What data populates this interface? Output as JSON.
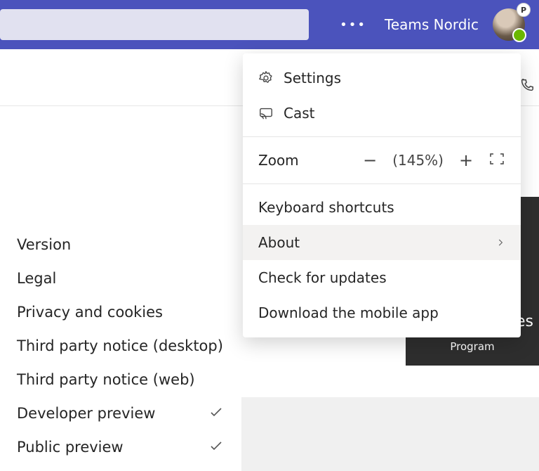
{
  "header": {
    "tenant_name": "Teams Nordic",
    "avatar_badge": "P"
  },
  "menu": {
    "settings": "Settings",
    "cast": "Cast",
    "zoom_label": "Zoom",
    "zoom_value": "(145%)",
    "keyboard_shortcuts": "Keyboard shortcuts",
    "about": "About",
    "check_updates": "Check for updates",
    "download_mobile": "Download the mobile app"
  },
  "about_submenu": {
    "items": [
      "Version",
      "Legal",
      "Privacy and cookies",
      "Third party notice (desktop)",
      "Third party notice (web)",
      "Developer preview",
      "Public preview"
    ]
  },
  "panel": {
    "program": "Program",
    "suffix": "es"
  }
}
